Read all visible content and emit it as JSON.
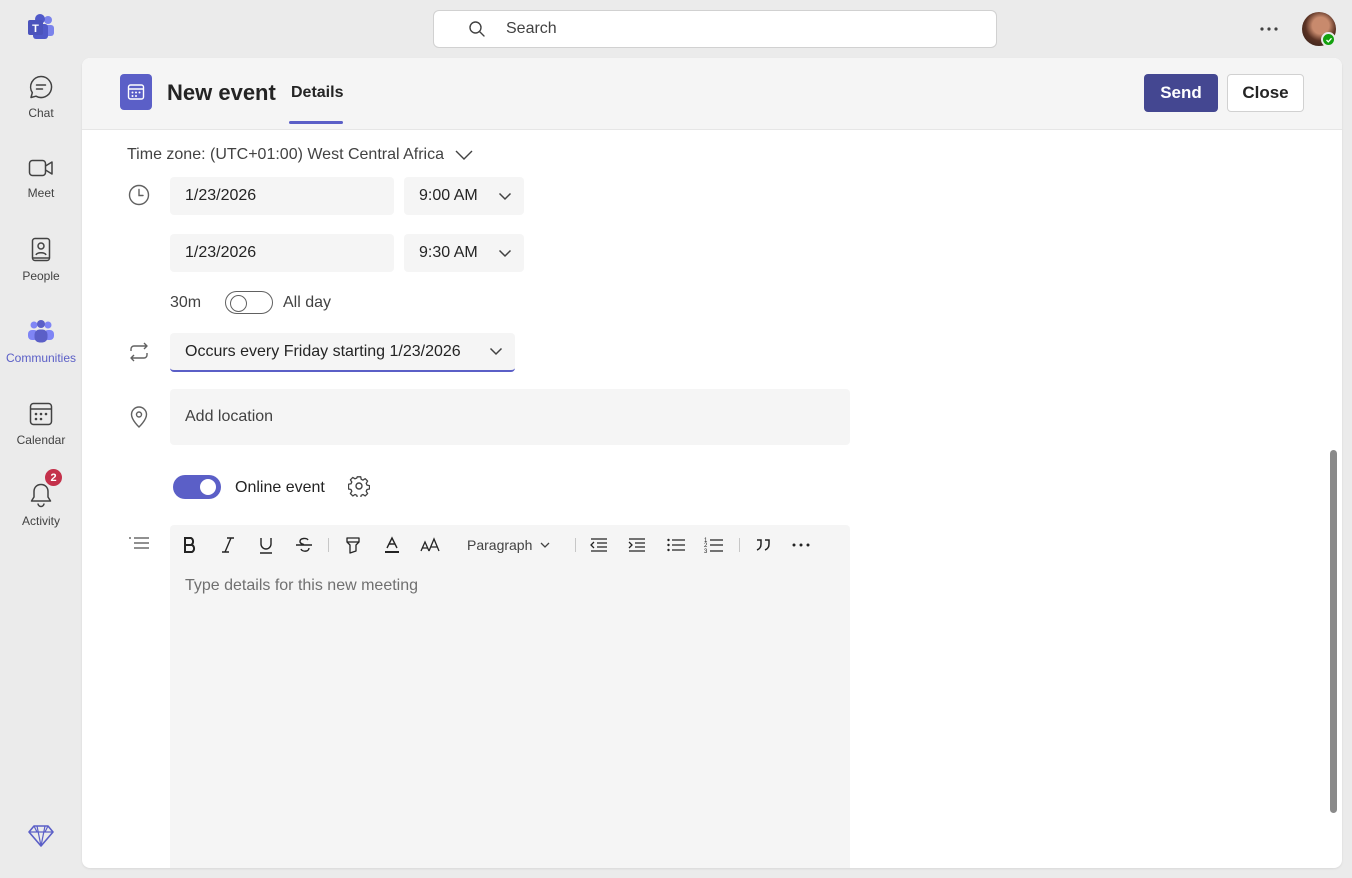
{
  "search": {
    "placeholder": "Search"
  },
  "rail": {
    "items": [
      {
        "label": "Chat",
        "icon": "chat-icon"
      },
      {
        "label": "Meet",
        "icon": "video-icon"
      },
      {
        "label": "People",
        "icon": "people-icon"
      },
      {
        "label": "Communities",
        "icon": "communities-icon",
        "active": true
      },
      {
        "label": "Calendar",
        "icon": "calendar-icon"
      },
      {
        "label": "Activity",
        "icon": "bell-icon",
        "badge": "2"
      }
    ]
  },
  "header": {
    "title": "New event",
    "tab": "Details",
    "send_label": "Send",
    "close_label": "Close"
  },
  "form": {
    "timezone": "Time zone: (UTC+01:00) West Central Africa",
    "start_date": "1/23/2026",
    "start_time": "9:00 AM",
    "end_date": "1/23/2026",
    "end_time": "9:30 AM",
    "duration": "30m",
    "all_day_label": "All day",
    "all_day": false,
    "recurrence": "Occurs every Friday starting 1/23/2026",
    "location_placeholder": "Add location",
    "online_event_label": "Online event",
    "online_event": true
  },
  "editor": {
    "paragraph_label": "Paragraph",
    "placeholder": "Type details for this new meeting"
  },
  "colors": {
    "accent": "#5b5fc7",
    "send": "#444791",
    "badge": "#c4314b"
  }
}
